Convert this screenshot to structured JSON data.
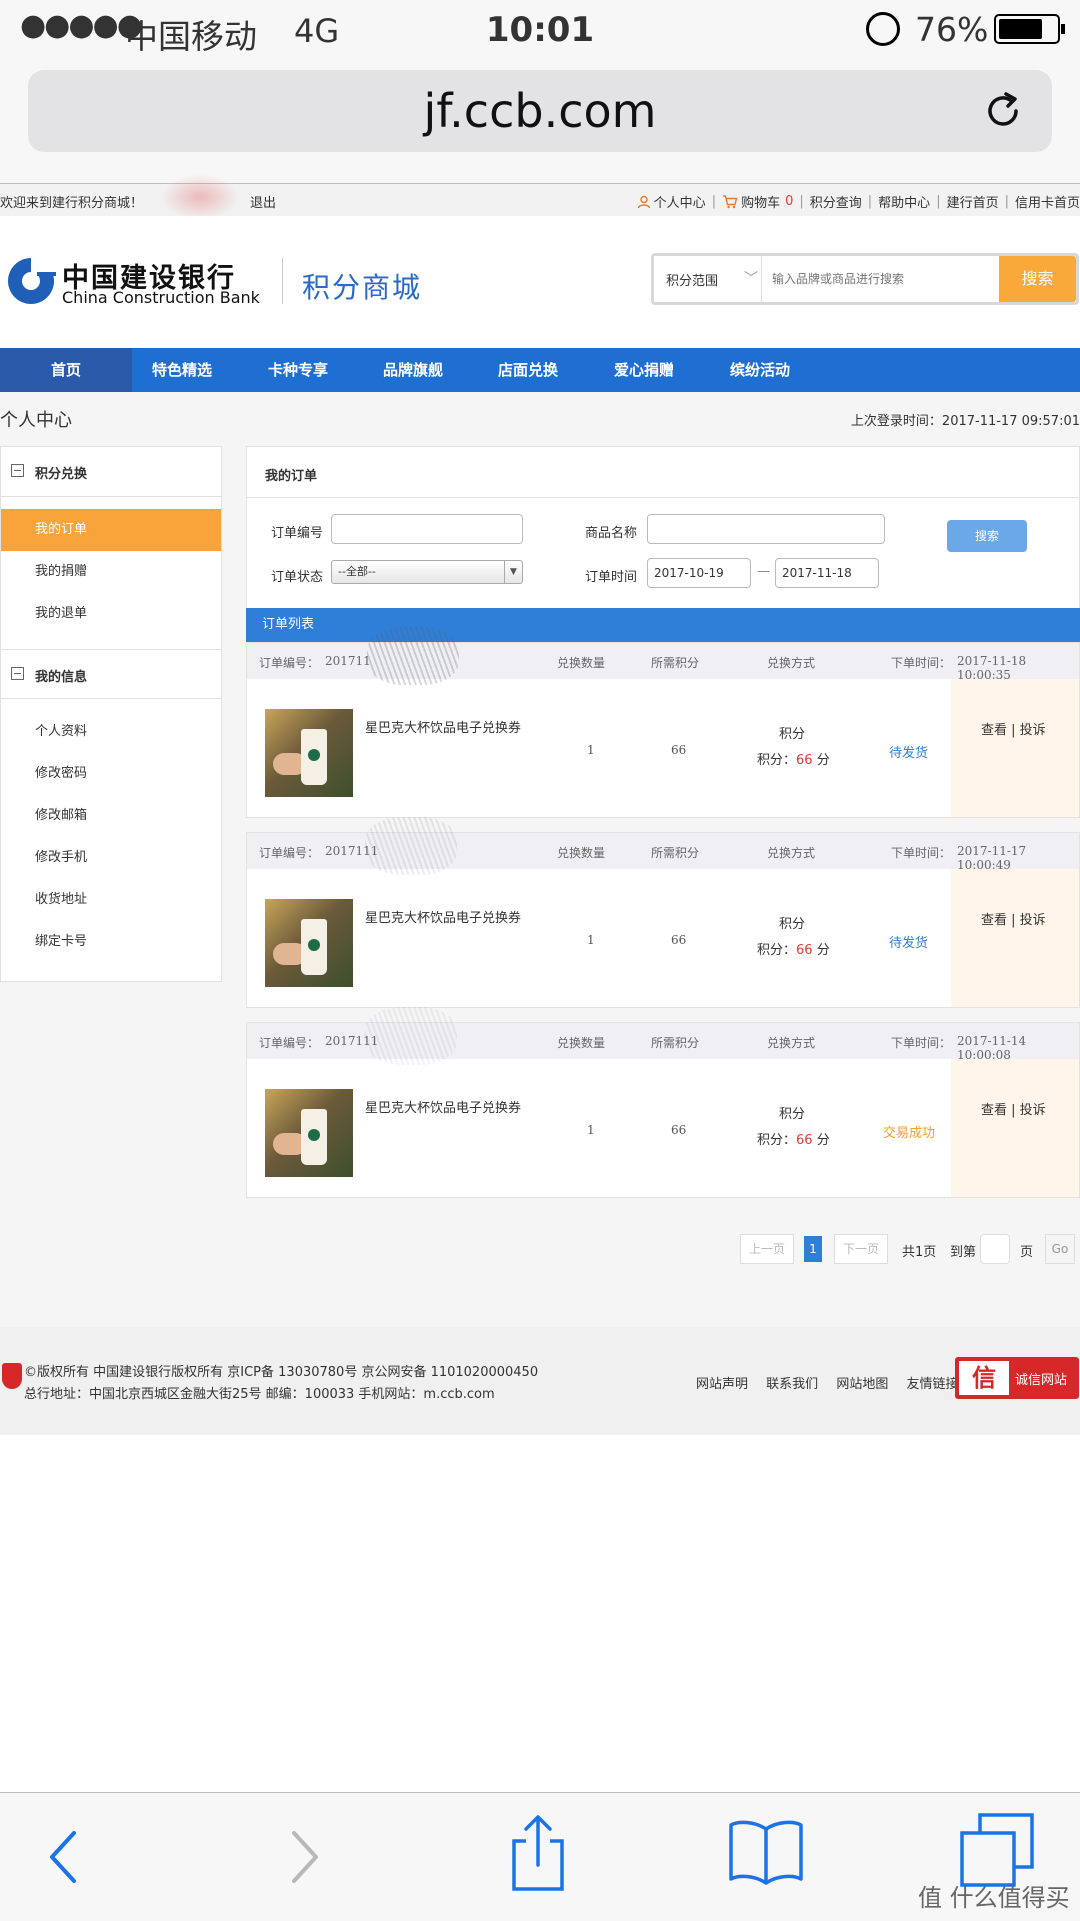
{
  "status_bar": {
    "signal": "●●●●●",
    "carrier": "中国移动",
    "network": "4G",
    "time": "10:01",
    "battery_percent": "76%",
    "battery_level": 0.76
  },
  "browser": {
    "url": "jf.ccb.com"
  },
  "topbar": {
    "welcome": "欢迎来到建行积分商城！",
    "logout": "退出",
    "links": {
      "personal_center": "个人中心",
      "cart": "购物车",
      "cart_count": "0",
      "points_query": "积分查询",
      "help_center": "帮助中心",
      "ccb_home": "建行首页",
      "credit_card_home": "信用卡首页"
    }
  },
  "header": {
    "logo_cn": "中国建设银行",
    "logo_en": "China Construction Bank",
    "mall_name": "积分商城",
    "search_scope": "积分范围",
    "search_placeholder": "输入品牌或商品进行搜索",
    "search_button": "搜索"
  },
  "nav": {
    "items": [
      "首页",
      "特色精选",
      "卡种专享",
      "品牌旗舰",
      "店面兑换",
      "爱心捐赠",
      "缤纷活动"
    ]
  },
  "page": {
    "breadcrumb": "个人中心",
    "last_login": "上次登录时间：2017-11-17 09:57:01"
  },
  "sidebar": {
    "section1": {
      "title": "积分兑换",
      "items": [
        "我的订单",
        "我的捐赠",
        "我的退单"
      ]
    },
    "section2": {
      "title": "我的信息",
      "items": [
        "个人资料",
        "修改密码",
        "修改邮箱",
        "修改手机",
        "收货地址",
        "绑定卡号"
      ]
    }
  },
  "orders_panel": {
    "title": "我的订单",
    "filters": {
      "order_no_label": "订单编号",
      "order_no_value": "",
      "product_label": "商品名称",
      "product_value": "",
      "status_label": "订单状态",
      "status_value": "--全部--",
      "time_label": "订单时间",
      "date_from": "2017-10-19",
      "date_sep": "—",
      "date_to": "2017-11-18",
      "search_button": "搜索"
    },
    "list_title": "订单列表",
    "columns": {
      "order_no_prefix": "订单编号：",
      "qty": "兑换数量",
      "points_needed": "所需积分",
      "exchange_mode": "兑换方式",
      "order_time_prefix": "下单时间："
    },
    "orders": [
      {
        "order_no": "201711",
        "order_time": "2017-11-18 10:00:35",
        "product": "星巴克大杯饮品电子兑换券",
        "qty": "1",
        "points": "66",
        "mode": "积分",
        "points_label": "积分：",
        "points_value": "66",
        "points_unit": "分",
        "status": "待发货",
        "actions": "查看 | 投诉"
      },
      {
        "order_no": "2017111",
        "order_time": "2017-11-17 10:00:49",
        "product": "星巴克大杯饮品电子兑换券",
        "qty": "1",
        "points": "66",
        "mode": "积分",
        "points_label": "积分：",
        "points_value": "66",
        "points_unit": "分",
        "status": "待发货",
        "actions": "查看 | 投诉"
      },
      {
        "order_no": "2017111",
        "order_time": "2017-11-14 10:00:08",
        "product": "星巴克大杯饮品电子兑换券",
        "qty": "1",
        "points": "66",
        "mode": "积分",
        "points_label": "积分：",
        "points_value": "66",
        "points_unit": "分",
        "status": "交易成功",
        "actions": "查看 | 投诉"
      }
    ],
    "pager": {
      "prev": "上一页",
      "current": "1",
      "next": "下一页",
      "total": "共1页",
      "goto": "到第",
      "page_unit": "页",
      "go": "Go"
    }
  },
  "footer": {
    "line1": "©版权所有 中国建设银行版权所有 京ICP备 13030780号 京公网安备 1101020000450",
    "line2": "总行地址：中国北京西城区金融大街25号 邮编：100033 手机网站：m.ccb.com",
    "links": [
      "网站声明",
      "联系我们",
      "网站地图",
      "友情链接"
    ],
    "trust_icon": "信",
    "trust_label": "诚信网站"
  },
  "watermark": "值 什么值得买",
  "icons": {
    "reload": "reload-icon",
    "back": "back-icon",
    "forward": "forward-icon",
    "share": "share-icon",
    "bookmarks": "bookmarks-icon",
    "tabs": "tabs-icon"
  },
  "colors": {
    "nav_blue": "#1e6fd1",
    "accent_orange": "#f9a43a",
    "link_blue": "#2f7ed8",
    "price_red": "#e53935"
  }
}
